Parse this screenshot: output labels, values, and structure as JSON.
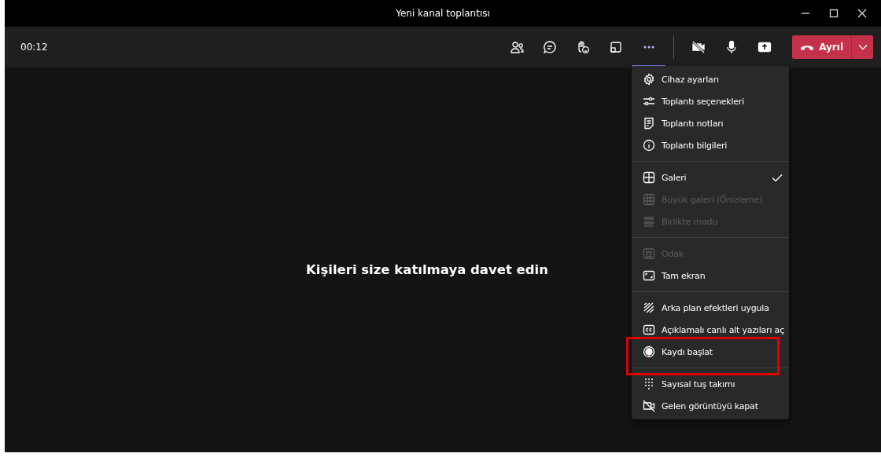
{
  "window": {
    "title": "Yeni kanal toplantısı"
  },
  "toolbar": {
    "timer": "00:12",
    "buttons": [
      {
        "kind": "people",
        "selected": false
      },
      {
        "kind": "chat",
        "selected": false
      },
      {
        "kind": "react",
        "selected": false
      },
      {
        "kind": "rooms",
        "selected": false
      },
      {
        "kind": "more",
        "selected": true
      }
    ],
    "devices": [
      {
        "kind": "camera",
        "on": false
      },
      {
        "kind": "mic",
        "on": true
      },
      {
        "kind": "share",
        "on": false
      }
    ],
    "leave": {
      "label": "Ayrıl"
    }
  },
  "stage": {
    "message": "Kişileri size katılmaya davet edin"
  },
  "menu": {
    "groups": [
      [
        {
          "label": "Cihaz ayarları",
          "disabled": false,
          "checked": false,
          "highlighted": false
        },
        {
          "label": "Toplantı seçenekleri",
          "disabled": false,
          "checked": false,
          "highlighted": false
        },
        {
          "label": "Toplantı notları",
          "disabled": false,
          "checked": false,
          "highlighted": false
        },
        {
          "label": "Toplantı bilgileri",
          "disabled": false,
          "checked": false,
          "highlighted": false
        }
      ],
      [
        {
          "label": "Galeri",
          "disabled": false,
          "checked": true,
          "highlighted": false
        },
        {
          "label": "Büyük galeri (Önizleme)",
          "disabled": true,
          "checked": false,
          "highlighted": false
        },
        {
          "label": "Birlikte modu",
          "disabled": true,
          "checked": false,
          "highlighted": false
        }
      ],
      [
        {
          "label": "Odak",
          "disabled": true,
          "checked": false,
          "highlighted": false
        },
        {
          "label": "Tam ekran",
          "disabled": false,
          "checked": false,
          "highlighted": false
        }
      ],
      [
        {
          "label": "Arka plan efektleri uygula",
          "disabled": false,
          "checked": false,
          "highlighted": false
        },
        {
          "label": "Açıklamalı canlı alt yazıları aç",
          "disabled": false,
          "checked": false,
          "highlighted": false
        },
        {
          "label": "Kaydı başlat",
          "disabled": false,
          "checked": false,
          "highlighted": true
        }
      ],
      [
        {
          "label": "Sayısal tuş takımı",
          "disabled": false,
          "checked": false,
          "highlighted": false
        },
        {
          "label": "Gelen görüntüyü kapat",
          "disabled": false,
          "checked": false,
          "highlighted": false
        }
      ]
    ]
  }
}
